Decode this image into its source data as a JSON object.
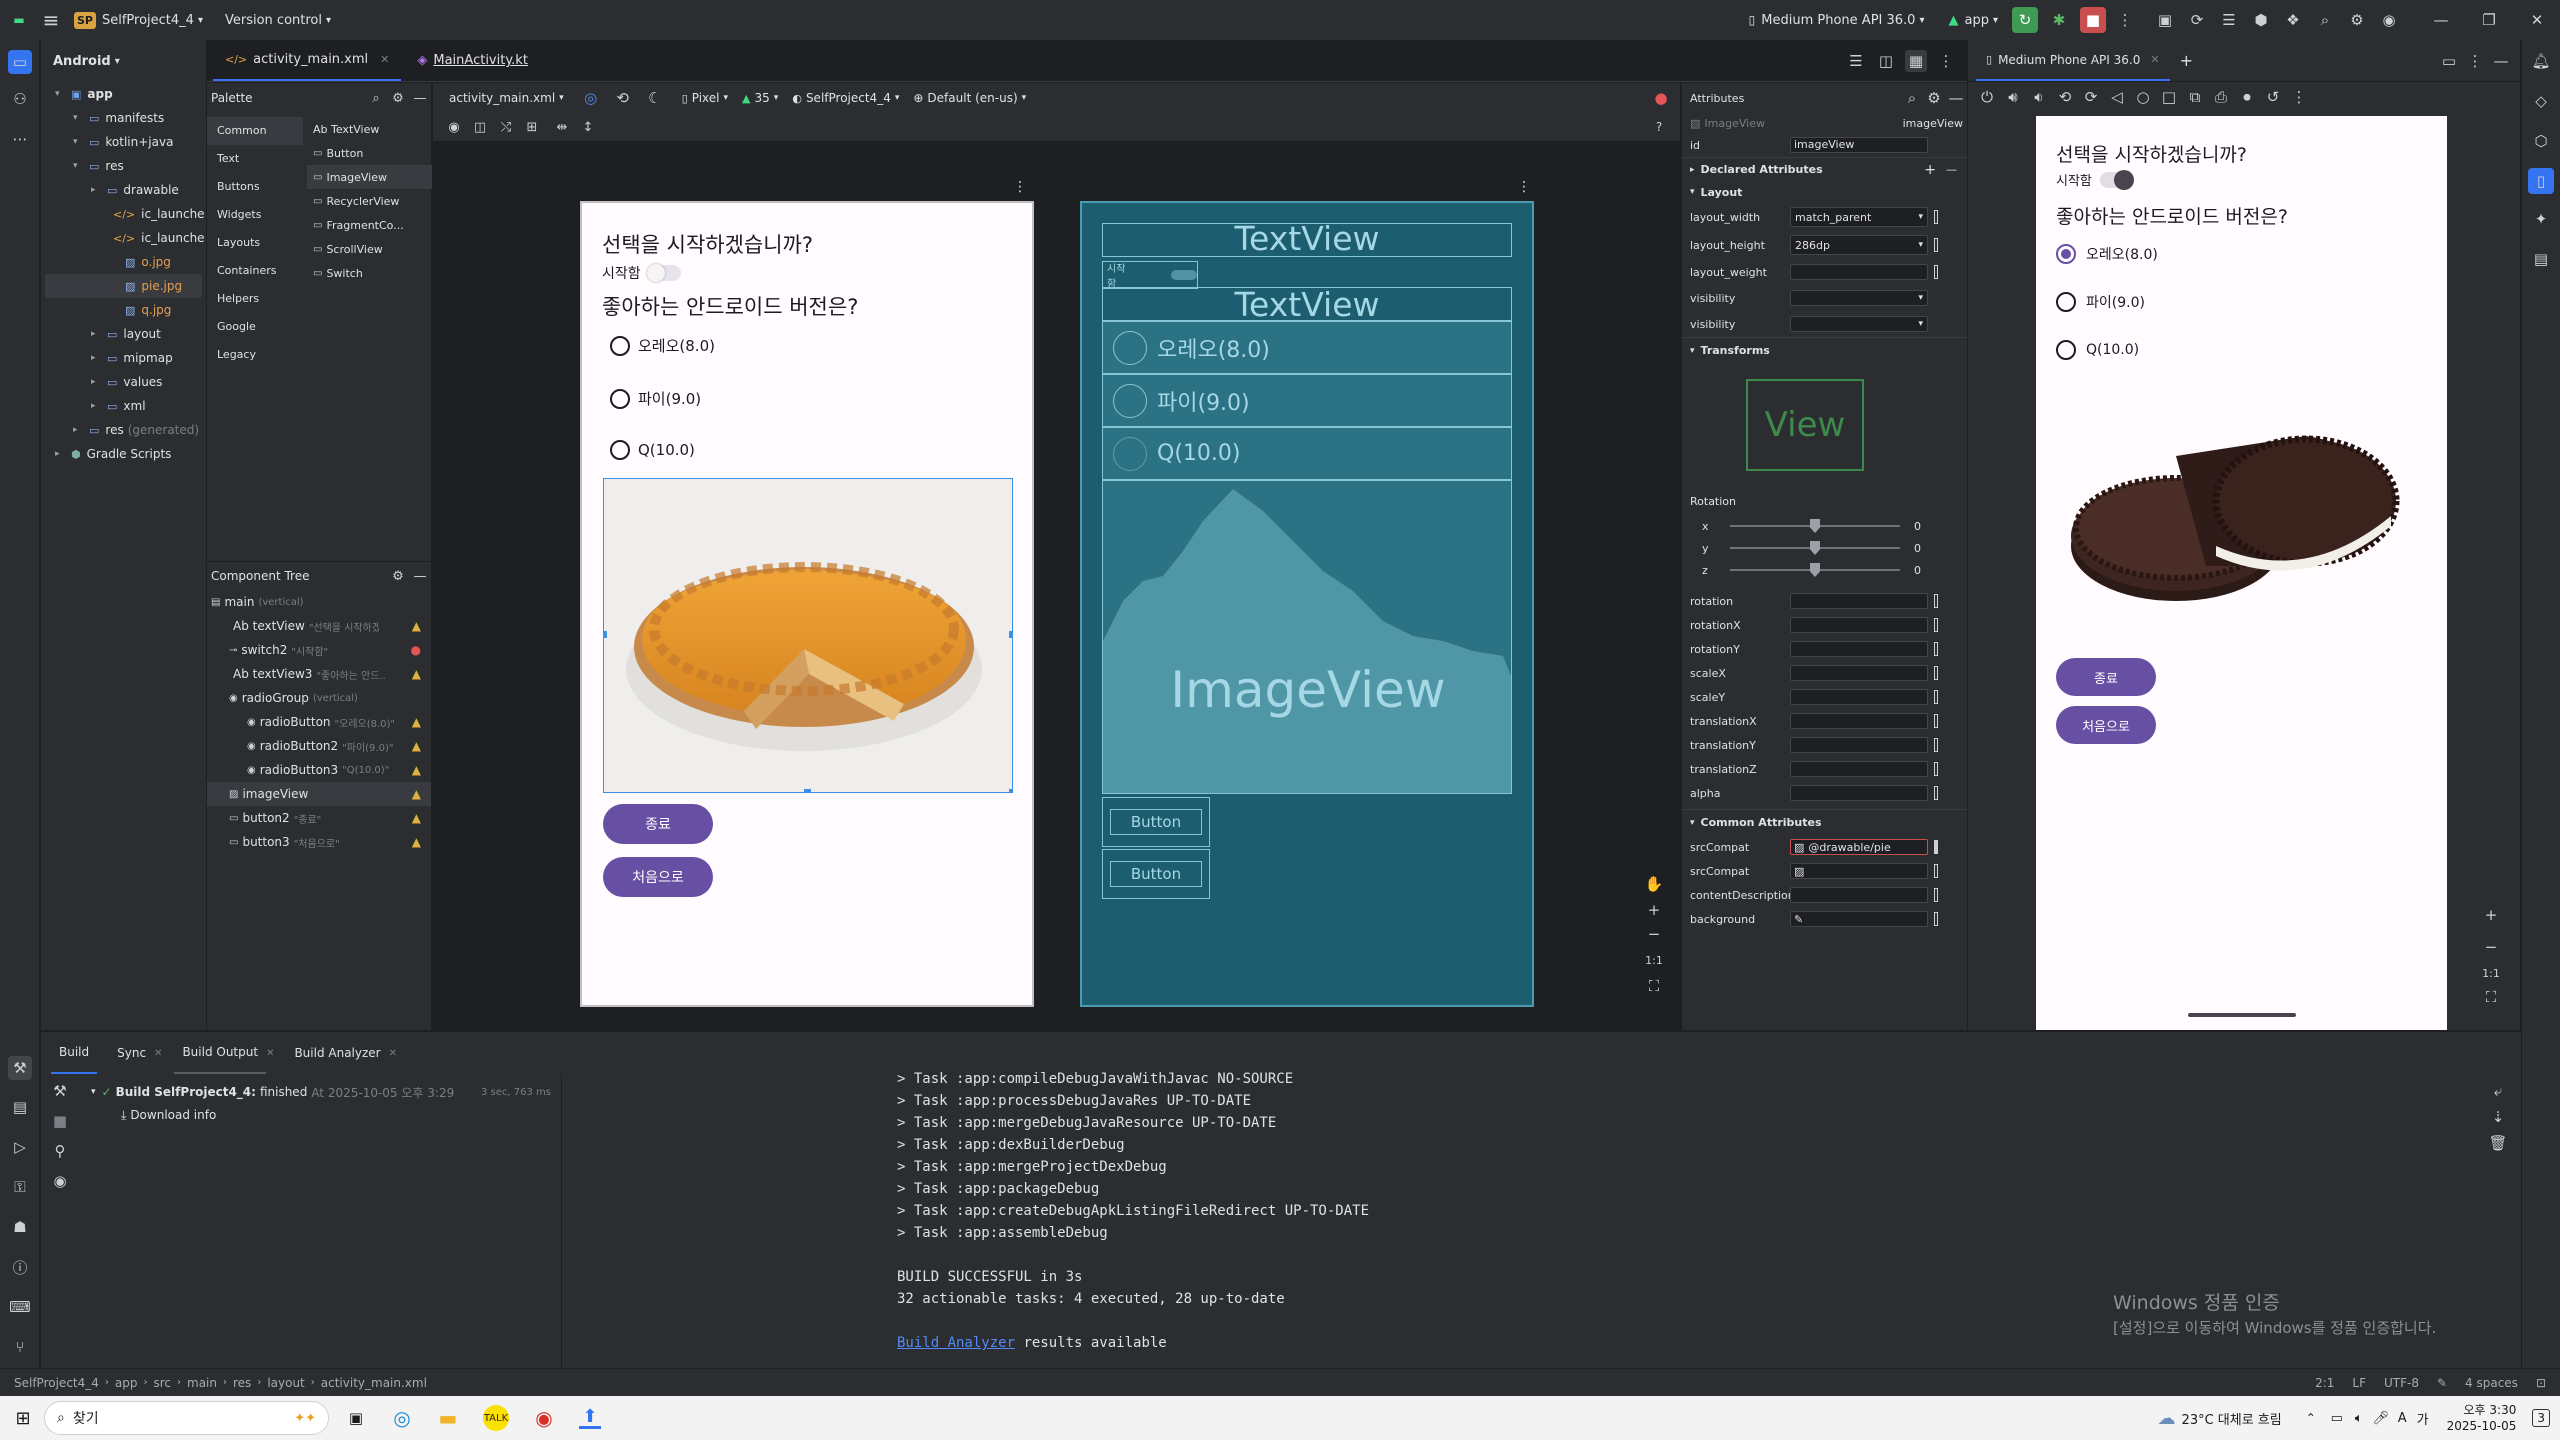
{
  "titlebar": {
    "project_badge": "SP",
    "project": "SelfProject4_4",
    "vcs": "Version control",
    "device": "Medium Phone API 36.0",
    "run_config": "app"
  },
  "activity": {
    "top": [
      "folder-icon",
      "commit-icon",
      "more-icon"
    ],
    "bottom": [
      "terminal-icon",
      "build-icon",
      "run-icon",
      "services-icon",
      "git-icon",
      "problems-icon",
      "console-icon",
      "branch-icon"
    ]
  },
  "project": {
    "view": "Android",
    "tree": [
      {
        "label": "app",
        "depth": 0,
        "icon": "module"
      },
      {
        "label": "manifests",
        "depth": 1,
        "icon": "folder"
      },
      {
        "label": "kotlin+java",
        "depth": 1,
        "icon": "folder"
      },
      {
        "label": "res",
        "depth": 1,
        "icon": "folder"
      },
      {
        "label": "drawable",
        "depth": 2,
        "icon": "folder"
      },
      {
        "label": "ic_launche",
        "depth": 3,
        "icon": "xml"
      },
      {
        "label": "ic_launche",
        "depth": 3,
        "icon": "xml"
      },
      {
        "label": "o.jpg",
        "depth": 3,
        "icon": "img"
      },
      {
        "label": "pie.jpg",
        "depth": 3,
        "icon": "img",
        "selected": true
      },
      {
        "label": "q.jpg",
        "depth": 3,
        "icon": "img"
      },
      {
        "label": "layout",
        "depth": 2,
        "icon": "folder"
      },
      {
        "label": "mipmap",
        "depth": 2,
        "icon": "folder"
      },
      {
        "label": "values",
        "depth": 2,
        "icon": "folder"
      },
      {
        "label": "xml",
        "depth": 2,
        "icon": "folder"
      },
      {
        "label": "res",
        "depth": 1,
        "icon": "folder",
        "suffix": "(generated)"
      },
      {
        "label": "Gradle Scripts",
        "depth": 0,
        "icon": "gradle"
      }
    ]
  },
  "tabs": [
    {
      "label": "activity_main.xml",
      "active": true
    },
    {
      "label": "MainActivity.kt",
      "active": false
    }
  ],
  "design_toolbar": {
    "file": "activity_main.xml",
    "device": "Pixel",
    "api": "35",
    "theme": "SelfProject4_4",
    "locale": "Default (en-us)"
  },
  "palette": {
    "title": "Palette",
    "categories": [
      "Common",
      "Text",
      "Buttons",
      "Widgets",
      "Layouts",
      "Containers",
      "Helpers",
      "Google",
      "Legacy"
    ],
    "items": [
      "Ab TextView",
      "Button",
      "ImageView",
      "RecyclerView",
      "FragmentCo...",
      "ScrollView",
      "Switch"
    ]
  },
  "component_tree": {
    "title": "Component Tree",
    "items": [
      {
        "label": "main",
        "extra": "(vertical)",
        "depth": 0,
        "status": ""
      },
      {
        "label": "Ab textView",
        "extra": "\"선택을 시작하겠...\"",
        "depth": 1,
        "status": "warn"
      },
      {
        "label": "switch2",
        "extra": "\"시작함\"",
        "depth": 1,
        "status": "err"
      },
      {
        "label": "Ab textView3",
        "extra": "\"좋아하는 안드...\"",
        "depth": 1,
        "status": "warn"
      },
      {
        "label": "radioGroup",
        "extra": "(vertical)",
        "depth": 1,
        "status": ""
      },
      {
        "label": "radioButton",
        "extra": "\"오레오(8.0)\"",
        "depth": 2,
        "status": "warn"
      },
      {
        "label": "radioButton2",
        "extra": "\"파이(9.0)\"",
        "depth": 2,
        "status": "warn"
      },
      {
        "label": "radioButton3",
        "extra": "\"Q(10.0)\"",
        "depth": 2,
        "status": "warn"
      },
      {
        "label": "imageView",
        "extra": "",
        "depth": 1,
        "status": "warn",
        "selected": true
      },
      {
        "label": "button2",
        "extra": "\"종료\"",
        "depth": 1,
        "status": "warn"
      },
      {
        "label": "button3",
        "extra": "\"처음으로\"",
        "depth": 1,
        "status": "warn"
      }
    ]
  },
  "design": {
    "question1": "선택을 시작하겠습니까?",
    "switch_label": "시작함",
    "question2": "좋아하는 안드로이드 버전은?",
    "radios": [
      "오레오(8.0)",
      "파이(9.0)",
      "Q(10.0)"
    ],
    "btn_end": "종료",
    "btn_restart": "처음으로"
  },
  "blueprint": {
    "textview": "TextView",
    "switch": "시작함",
    "radios": [
      "오레오(8.0)",
      "파이(9.0)",
      "Q(10.0)"
    ],
    "imageview": "ImageView",
    "button": "Button"
  },
  "attributes": {
    "title": "Attributes",
    "type": "ImageView",
    "id_name": "imageView",
    "id_label": "id",
    "id_value": "imageView",
    "declared": "Declared Attributes",
    "layout": "Layout",
    "layout_width_label": "layout_width",
    "layout_width": "match_parent",
    "layout_height_label": "layout_height",
    "layout_height": "286dp",
    "layout_weight": "layout_weight",
    "visibility": "visibility",
    "visibility2": "visibility",
    "transforms": "Transforms",
    "view": "View",
    "rotation_title": "Rotation",
    "axes": [
      {
        "label": "x",
        "value": "0"
      },
      {
        "label": "y",
        "value": "0"
      },
      {
        "label": "z",
        "value": "0"
      }
    ],
    "props": [
      "rotation",
      "rotationX",
      "rotationY",
      "scaleX",
      "scaleY",
      "translationX",
      "translationY",
      "translationZ",
      "alpha"
    ],
    "common": "Common Attributes",
    "src_label": "srcCompat",
    "src_value": "@drawable/pie",
    "src2_label": "srcCompat",
    "content_desc": "contentDescription",
    "background": "background"
  },
  "emulator": {
    "tab": "Medium Phone API 36.0",
    "question1": "선택을 시작하겠습니까?",
    "switch_label": "시작함",
    "question2": "좋아하는 안드로이드 버전은?",
    "radios": [
      "오레오(8.0)",
      "파이(9.0)",
      "Q(10.0)"
    ],
    "selected_index": 0,
    "btn_end": "종료",
    "btn_restart": "처음으로"
  },
  "build": {
    "tabs": [
      "Build",
      "Sync",
      "Build Output",
      "Build Analyzer"
    ],
    "entry": "Build SelfProject4_4:",
    "entry_status": "finished",
    "entry_time": "At 2025-10-05 오후 3:29",
    "duration": "3 sec, 763 ms",
    "download": "Download info",
    "log": [
      "> Task :app:compileDebugJavaWithJavac NO-SOURCE",
      "> Task :app:processDebugJavaRes UP-TO-DATE",
      "> Task :app:mergeDebugJavaResource UP-TO-DATE",
      "> Task :app:dexBuilderDebug",
      "> Task :app:mergeProjectDexDebug",
      "> Task :app:packageDebug",
      "> Task :app:createDebugApkListingFileRedirect UP-TO-DATE",
      "> Task :app:assembleDebug",
      "",
      "BUILD SUCCESSFUL in 3s",
      "32 actionable tasks: 4 executed, 28 up-to-date",
      ""
    ],
    "analyzer_link": "Build Analyzer",
    "analyzer_rest": " results available"
  },
  "watermark": {
    "line1": "Windows 정품 인증",
    "line2": "[설정]으로 이동하여 Windows를 정품 인증합니다."
  },
  "statusbar": {
    "crumbs": [
      "SelfProject4_4",
      "app",
      "src",
      "main",
      "res",
      "layout",
      "activity_main.xml"
    ],
    "pos": "2:1",
    "lf": "LF",
    "enc": "UTF-8",
    "indent": "4 spaces"
  },
  "taskbar": {
    "search": "찾기",
    "weather": "23°C 대체로 흐림",
    "ime1": "A",
    "ime2": "가",
    "time": "오후 3:30",
    "date": "2025-10-05",
    "notif": "3"
  }
}
